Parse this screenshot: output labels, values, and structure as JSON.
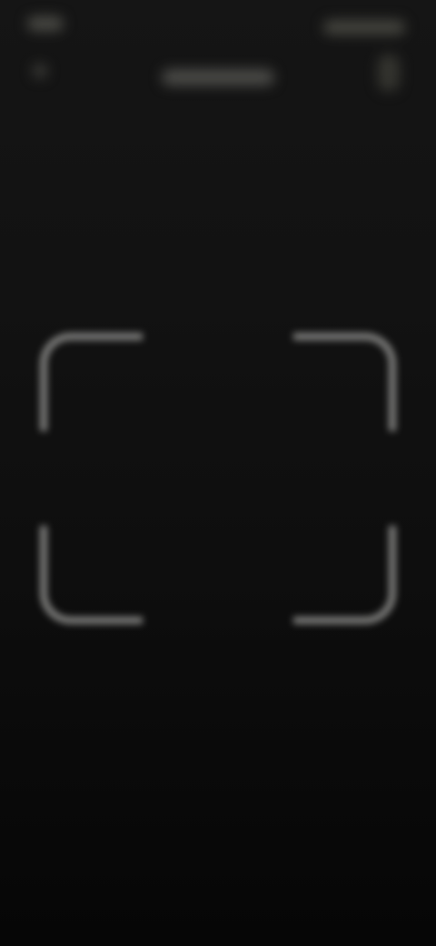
{
  "screen": {
    "background": "#0b0b0b",
    "accent": "#8a8a88"
  },
  "status_bar": {
    "left_icon": "time-indicator",
    "center_icon": "title-placeholder",
    "right_icon": "status-icons"
  },
  "scanner": {
    "frame_icon": "scan-frame-icon"
  }
}
